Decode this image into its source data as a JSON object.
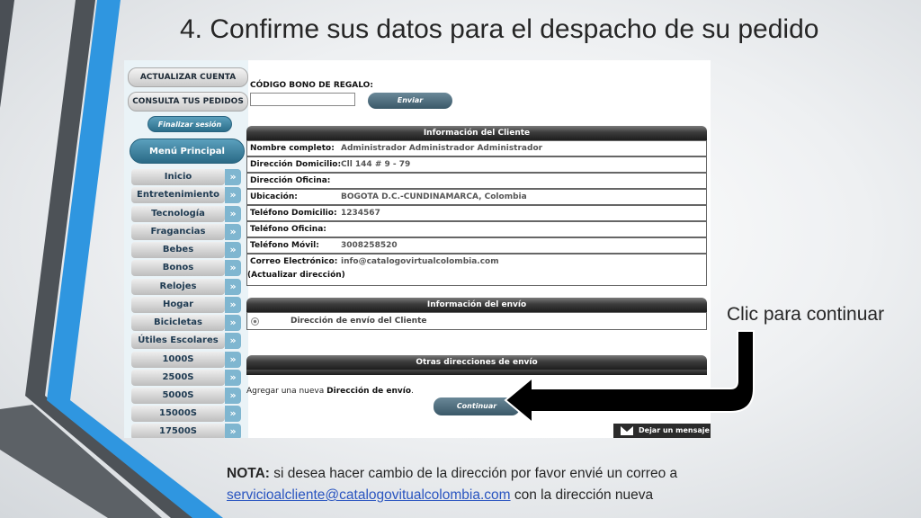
{
  "slide": {
    "title": "4. Confirme sus datos para el despacho de su pedido",
    "callout": "Clic para continuar",
    "note_bold": "NOTA:",
    "note_text1": " si desea hacer cambio de la dirección por favor envié un correo a",
    "note_email": "servicioalcliente@catalogovitualcolombia.com",
    "note_text2": " con la dirección nueva"
  },
  "sidebar": {
    "update_account": "ACTUALIZAR CUENTA",
    "my_orders": "CONSULTA TUS PEDIDOS",
    "logout": "Finalizar sesión",
    "menu_title": "Menú Principal",
    "items": [
      "Inicio",
      "Entretenimiento",
      "Tecnología",
      "Fragancias",
      "Bebes",
      "Bonos",
      "Relojes",
      "Hogar",
      "Bicicletas",
      "Útiles Escolares",
      "1000S",
      "2500S",
      "5000S",
      "15000S",
      "17500S"
    ]
  },
  "gift": {
    "label": "CÓDIGO BONO DE REGALO:",
    "value": "",
    "send": "Enviar"
  },
  "client_info": {
    "header": "Información del Cliente",
    "rows": [
      {
        "label": "Nombre completo:",
        "value": "Administrador Administrador Administrador"
      },
      {
        "label": "Dirección Domicilio:",
        "value": "Cll 144 # 9 - 79"
      },
      {
        "label": "Dirección Oficina:",
        "value": ""
      },
      {
        "label": "Ubicación:",
        "value": "BOGOTA D.C.-CUNDINAMARCA, Colombia"
      },
      {
        "label": "Teléfono Domicilio:",
        "value": "1234567"
      },
      {
        "label": "Teléfono Oficina:",
        "value": ""
      },
      {
        "label": "Teléfono Móvil:",
        "value": "3008258520"
      },
      {
        "label": "Correo Electrónico:",
        "value": "info@catalogovirtualcolombia.com"
      }
    ],
    "update_address": "(Actualizar dirección)"
  },
  "shipping": {
    "header": "Información del envío",
    "option": "Dirección de envío del Cliente",
    "other_header": "Otras direcciones de envío",
    "add_prefix": "Agregar una nueva ",
    "add_bold": "Dirección de envío",
    "add_suffix": ".",
    "continue": "Continuar"
  },
  "chat": {
    "label": "Dejar un mensaje"
  },
  "colors": {
    "accent_blue": "#2f8fd8",
    "arrow": "#000000",
    "menu_blue": "#3d86a6"
  }
}
